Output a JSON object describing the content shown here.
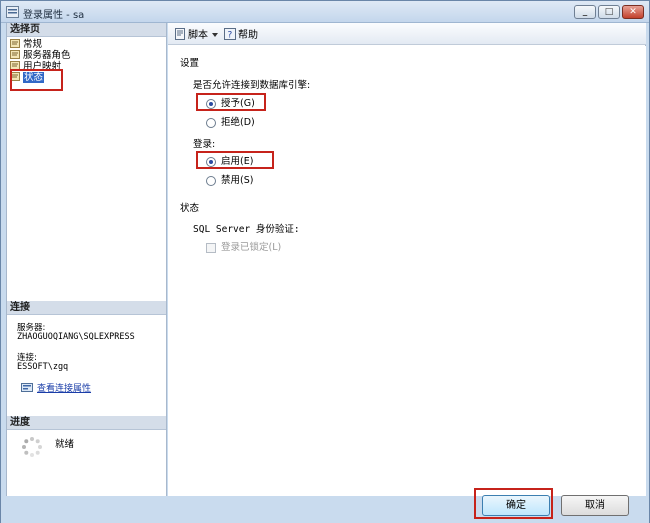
{
  "window": {
    "title": "登录属性 - sa"
  },
  "sidebar": {
    "select_page_header": "选择页",
    "items": [
      {
        "label": "常规",
        "selected": false
      },
      {
        "label": "服务器角色",
        "selected": false
      },
      {
        "label": "用户映射",
        "selected": false
      },
      {
        "label": "状态",
        "selected": true
      }
    ],
    "connection": {
      "header": "连接",
      "server_label": "服务器:",
      "server_value": "ZHAOGUOQIANG\\SQLEXPRESS",
      "conn_label": "连接:",
      "conn_value": "ESSOFT\\zgq",
      "view_link": "查看连接属性"
    },
    "progress": {
      "header": "进度",
      "status": "就绪"
    }
  },
  "toolbar": {
    "script_label": "脚本",
    "help_label": "帮助"
  },
  "settings": {
    "section_label": "设置",
    "db_engine_question": "是否允许连接到数据库引擎:",
    "grant_label": "授予(G)",
    "deny_label": "拒绝(D)",
    "grant_selected": true,
    "login_label": "登录:",
    "enable_label": "启用(E)",
    "disable_label": "禁用(S)",
    "enable_selected": true
  },
  "status": {
    "section_label": "状态",
    "auth_label": "SQL Server 身份验证:",
    "locked_label": "登录已锁定(L)",
    "locked_checked": false
  },
  "buttons": {
    "ok": "确定",
    "cancel": "取消"
  }
}
